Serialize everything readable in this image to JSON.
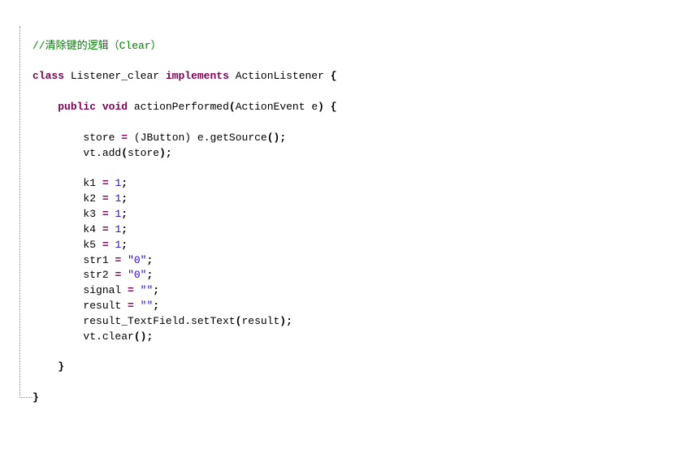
{
  "code": {
    "comment": "//清除键的逻辑（Clear）",
    "classDecl": {
      "kw_class": "class",
      "className": "Listener_clear",
      "kw_implements": "implements",
      "iface": "ActionListener",
      "brace": "{"
    },
    "methodDecl": {
      "kw_public": "public",
      "kw_void": "void",
      "methodName": "actionPerformed",
      "paramType": "ActionEvent",
      "paramName": "e",
      "brace": "{"
    },
    "l_store": {
      "lhs": "store",
      "eq": "=",
      "cast_open": "(",
      "cast_type": "JButton",
      "cast_close": ")",
      "expr": "e.getSource",
      "call": "();"
    },
    "l_vtadd": {
      "obj": "vt.add",
      "open": "(",
      "arg": "store",
      "close": ");"
    },
    "l_k1": {
      "lhs": "k1",
      "eq": "=",
      "val": "1",
      "semi": ";"
    },
    "l_k2": {
      "lhs": "k2",
      "eq": "=",
      "val": "1",
      "semi": ";"
    },
    "l_k3": {
      "lhs": "k3",
      "eq": "=",
      "val": "1",
      "semi": ";"
    },
    "l_k4": {
      "lhs": "k4",
      "eq": "=",
      "val": "1",
      "semi": ";"
    },
    "l_k5": {
      "lhs": "k5",
      "eq": "=",
      "val": "1",
      "semi": ";"
    },
    "l_str1": {
      "lhs": "str1",
      "eq": "=",
      "val": "\"0\"",
      "semi": ";"
    },
    "l_str2": {
      "lhs": "str2",
      "eq": "=",
      "val": "\"0\"",
      "semi": ";"
    },
    "l_signal": {
      "lhs": "signal",
      "eq": "=",
      "val": "\"\"",
      "semi": ";"
    },
    "l_result": {
      "lhs": "result",
      "eq": "=",
      "val": "\"\"",
      "semi": ";"
    },
    "l_settext": {
      "obj": "result_TextField.setText",
      "open": "(",
      "arg": "result",
      "close": ");"
    },
    "l_vtclear": {
      "expr": "vt.clear",
      "call": "();"
    },
    "brace_close_method": "}",
    "brace_close_class": "}"
  }
}
